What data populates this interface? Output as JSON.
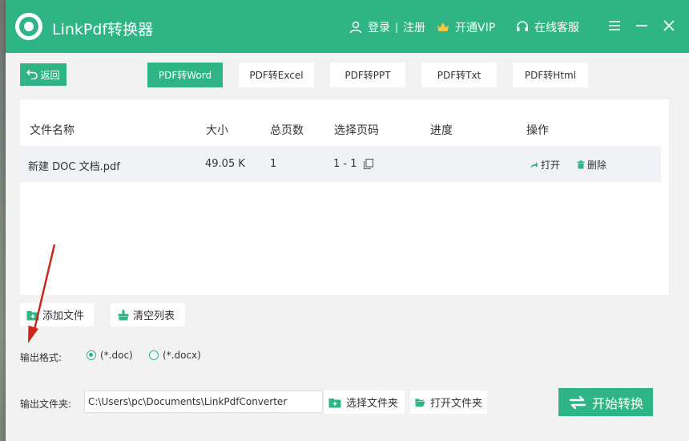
{
  "app": {
    "title": "LinkPdf转换器",
    "accent": "#2fb585"
  },
  "header": {
    "login_label": "登录",
    "separator": "|",
    "register_label": "注册",
    "vip_label": "开通VIP",
    "service_label": "在线客服"
  },
  "toolbar": {
    "back_label": "返回",
    "tabs": [
      {
        "label": "PDF转Word",
        "active": true
      },
      {
        "label": "PDF转Excel",
        "active": false
      },
      {
        "label": "PDF转PPT",
        "active": false
      },
      {
        "label": "PDF转Txt",
        "active": false
      },
      {
        "label": "PDF转Html",
        "active": false
      }
    ]
  },
  "table": {
    "columns": [
      "文件名称",
      "大小",
      "总页数",
      "选择页码",
      "进度",
      "操作"
    ],
    "rows": [
      {
        "name": "新建 DOC 文档.pdf",
        "size": "49.05 K",
        "pages": "1",
        "page_range": "1 - 1",
        "progress": "",
        "open_label": "打开",
        "delete_label": "删除"
      }
    ]
  },
  "actions": {
    "add_file_label": "添加文件",
    "clear_list_label": "清空列表"
  },
  "output_format": {
    "label": "输出格式:",
    "options": [
      {
        "label": "(*.doc)",
        "selected": true
      },
      {
        "label": "(*.docx)",
        "selected": false
      }
    ]
  },
  "output_folder": {
    "label": "输出文件夹:",
    "path": "C:\\Users\\pc\\Documents\\LinkPdfConverter",
    "choose_label": "选择文件夹",
    "open_label": "打开文件夹"
  },
  "start_label": "开始转换"
}
